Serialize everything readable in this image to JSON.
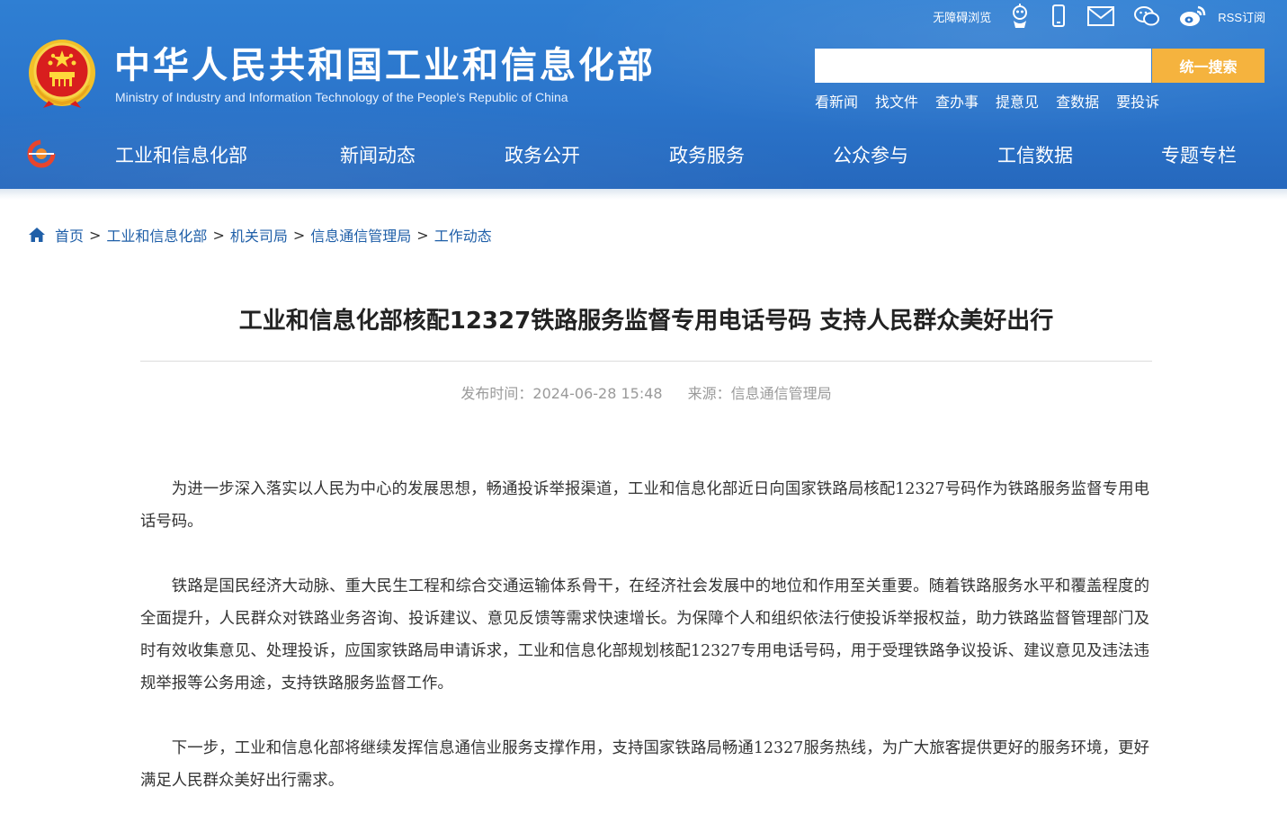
{
  "header": {
    "site_title": "中华人民共和国工业和信息化部",
    "site_subtitle": "Ministry of Industry and Information Technology of the People's Republic of China",
    "accessibility_label": "无障碍浏览",
    "rss_label": "RSS订阅",
    "search": {
      "placeholder": "",
      "value": "",
      "button_label": "统一搜索"
    },
    "quick_links": [
      "看新闻",
      "找文件",
      "查办事",
      "提意见",
      "查数据",
      "要投诉"
    ],
    "nav_items": [
      "工业和信息化部",
      "新闻动态",
      "政务公开",
      "政务服务",
      "公众参与",
      "工信数据",
      "专题专栏"
    ]
  },
  "breadcrumb": {
    "items": [
      "首页",
      "工业和信息化部",
      "机关司局",
      "信息通信管理局",
      "工作动态"
    ],
    "separator": ">"
  },
  "article": {
    "title": "工业和信息化部核配12327铁路服务监督专用电话号码 支持人民群众美好出行",
    "publish_label": "发布时间：2024-06-28 15:48",
    "source_label": "来源：信息通信管理局",
    "paragraphs": [
      "为进一步深入落实以人民为中心的发展思想，畅通投诉举报渠道，工业和信息化部近日向国家铁路局核配12327号码作为铁路服务监督专用电话号码。",
      "铁路是国民经济大动脉、重大民生工程和综合交通运输体系骨干，在经济社会发展中的地位和作用至关重要。随着铁路服务水平和覆盖程度的全面提升，人民群众对铁路业务咨询、投诉建议、意见反馈等需求快速增长。为保障个人和组织依法行使投诉举报权益，助力铁路监督管理部门及时有效收集意见、处理投诉，应国家铁路局申请诉求，工业和信息化部规划核配12327专用电话号码，用于受理铁路争议投诉、建议意见及违法违规举报等公务用途，支持铁路服务监督工作。",
      "下一步，工业和信息化部将继续发挥信息通信业服务支撑作用，支持国家铁路局畅通12327服务热线，为广大旅客提供更好的服务环境，更好满足人民群众美好出行需求。"
    ]
  },
  "colors": {
    "header_blue": "#2b75cb",
    "search_button": "#f5b33e",
    "link_blue": "#1f5fa8",
    "meta_gray": "#9a9a9a"
  },
  "icons": [
    "national-emblem-icon",
    "robot-icon",
    "mobile-icon",
    "mail-icon",
    "wechat-icon",
    "weibo-icon",
    "nav-logo-icon",
    "home-icon"
  ]
}
